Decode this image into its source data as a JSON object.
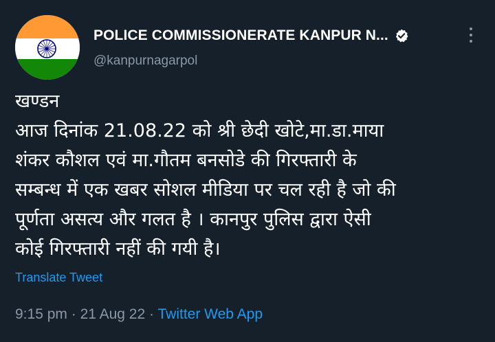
{
  "account": {
    "display_name": "POLICE COMMISSIONERATE KANPUR N...",
    "handle": "@kanpurnagarpol",
    "verified_icon": "verified-badge-icon",
    "avatar": "india-flag"
  },
  "tweet": {
    "lines": [
      "खण्डन",
      "आज दिनांक 21.08.22 को श्री छेदी खोटे,मा.डा.माया",
      "शंकर कौशल एवं मा.गौतम बनसोडे की गिरफ्तारी के",
      "सम्बन्ध में एक खबर सोशल मीडिया पर चल रही है जो की",
      "पूर्णता असत्य और गलत है । कानपुर पुलिस द्वारा ऐसी",
      "कोई गिरफ्तारी नहीं की गयी है।"
    ],
    "translate_label": "Translate Tweet",
    "time": "9:15 pm",
    "separator": "·",
    "date": "21 Aug 22",
    "source": "Twitter Web App"
  },
  "colors": {
    "background": "#15202b",
    "accent": "#1d9bf0",
    "secondary_text": "#8b98a5",
    "saffron": "#ff9933",
    "green": "#138808",
    "chakra": "#000080"
  }
}
